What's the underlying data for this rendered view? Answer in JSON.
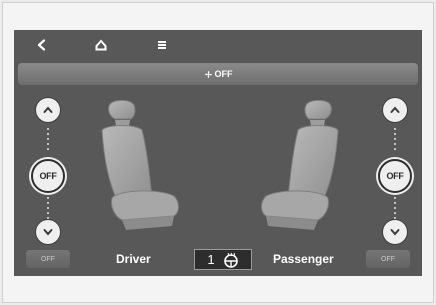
{
  "banner": {
    "label": "OFF",
    "icon": "fan-icon"
  },
  "driver": {
    "level": "OFF",
    "label": "Driver",
    "off_button": "OFF"
  },
  "passenger": {
    "level": "OFF",
    "label": "Passenger",
    "off_button": "OFF"
  },
  "steering": {
    "level": "1",
    "icon": "heated-steering-wheel-icon"
  }
}
